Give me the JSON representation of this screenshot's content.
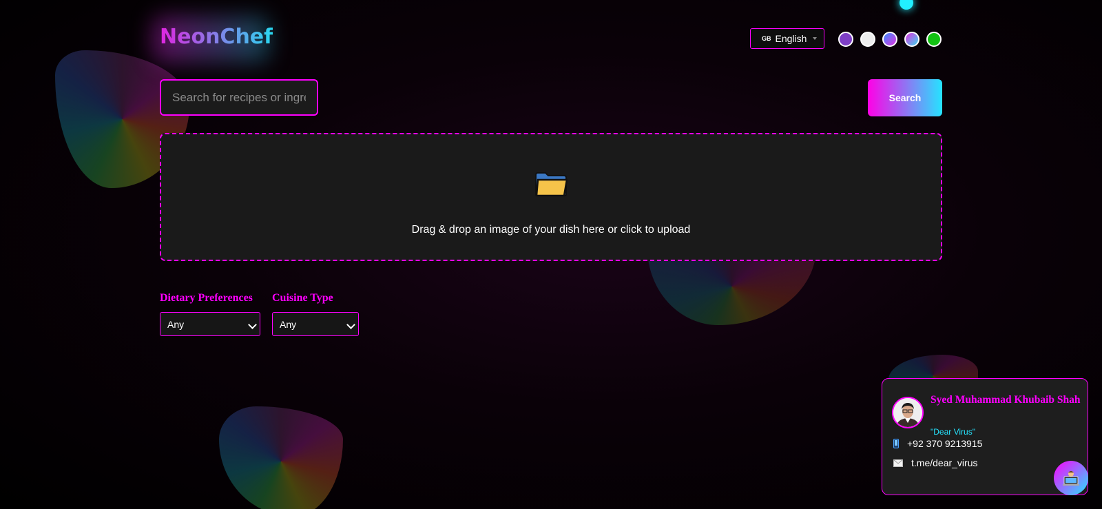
{
  "app": {
    "logo": "NeonChef"
  },
  "header": {
    "language": {
      "flag": "GB",
      "label": "English"
    },
    "theme_swatches": [
      {
        "name": "purple",
        "color": "#7e3fc6"
      },
      {
        "name": "white",
        "color": "#eeeeee"
      },
      {
        "name": "blue-pink",
        "color": "linear-gradient(135deg,#3a8cff,#e033e0)"
      },
      {
        "name": "magenta-cyan",
        "color": "linear-gradient(135deg,#e033e0,#3ad8f0)"
      },
      {
        "name": "green",
        "color": "#12c212"
      }
    ]
  },
  "search": {
    "placeholder": "Search for recipes or ingredients...",
    "button_label": "Search"
  },
  "upload": {
    "icon": "folder-icon",
    "text": "Drag & drop an image of your dish here or click to upload"
  },
  "filters": {
    "dietary": {
      "label": "Dietary Preferences",
      "selected": "Any"
    },
    "cuisine": {
      "label": "Cuisine Type",
      "selected": "Any"
    }
  },
  "contact_card": {
    "name": "Syed Muhammad Khubaib Shah",
    "nickname": "\"Dear Virus\"",
    "phone_icon": "phone-icon",
    "phone": "+92 370 9213915",
    "email_icon": "envelope-icon",
    "telegram": "t.me/dear_virus"
  },
  "fab": {
    "icon": "laptop-user-icon"
  },
  "colors": {
    "accent_magenta": "#ff00ff",
    "accent_cyan": "#25e4ff",
    "panel_bg": "#1a1a1a"
  }
}
